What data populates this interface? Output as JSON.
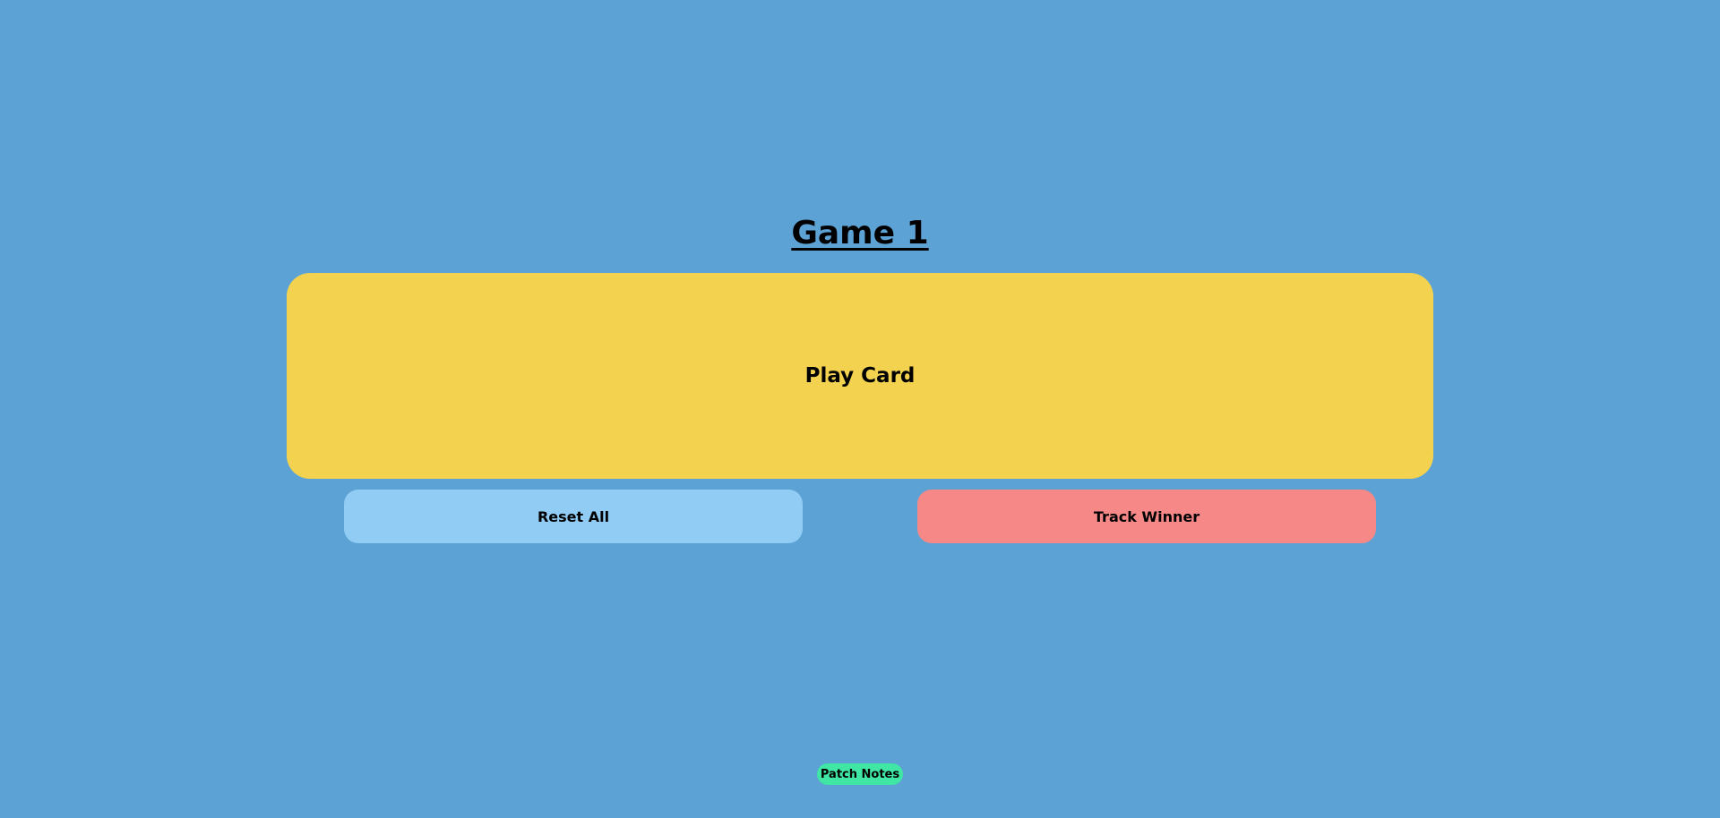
{
  "page": {
    "title": "Game 1",
    "background_color": "#5da2d5"
  },
  "play_card": {
    "label": "Play Card",
    "color": "#f3d250"
  },
  "actions": {
    "reset_label": "Reset All",
    "reset_color": "#90ccf4",
    "track_label": "Track Winner",
    "track_color": "#f78888"
  },
  "footer": {
    "patch_notes_label": "Patch Notes",
    "patch_notes_color": "#40e6a4"
  }
}
